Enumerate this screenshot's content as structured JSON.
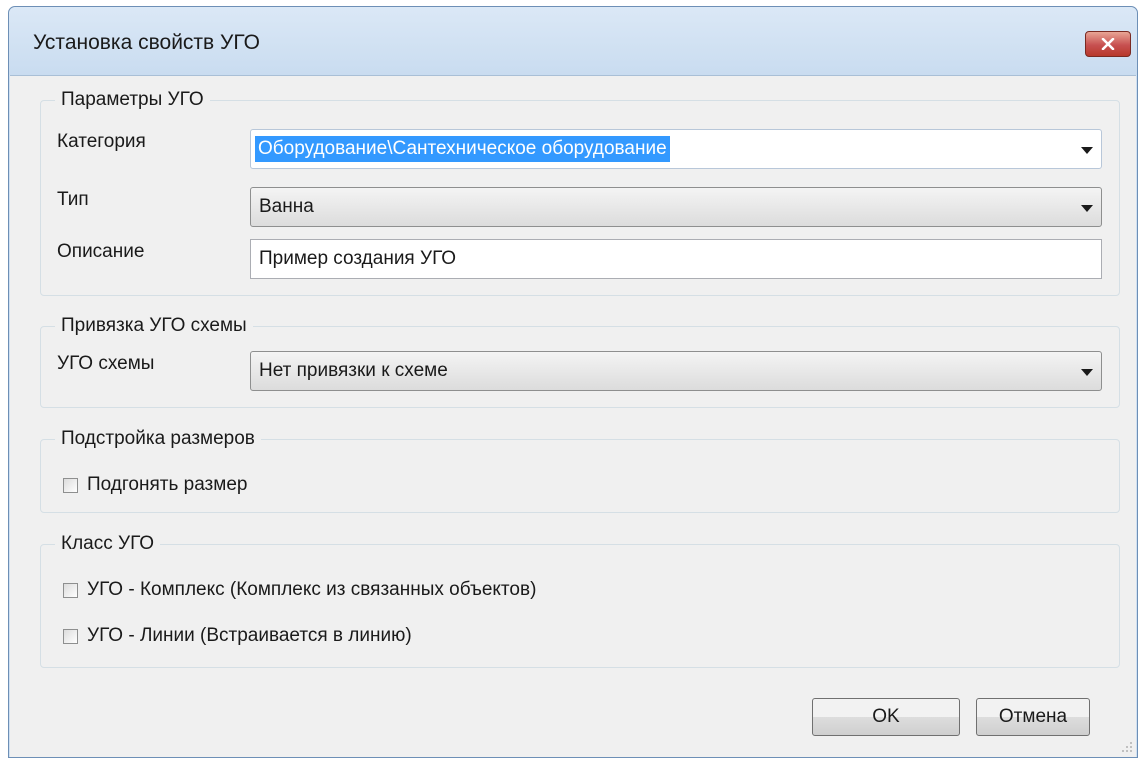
{
  "window": {
    "title": "Установка свойств УГО"
  },
  "group_params": {
    "legend": "Параметры УГО",
    "category_label": "Категория",
    "category_value": "Оборудование\\Сантехническое оборудование",
    "type_label": "Тип",
    "type_value": "Ванна",
    "description_label": "Описание",
    "description_value": "Пример создания УГО"
  },
  "group_binding": {
    "legend": "Привязка УГО схемы",
    "scheme_label": "УГО схемы",
    "scheme_value": "Нет привязки к схеме"
  },
  "group_size": {
    "legend": "Подстройка размеров",
    "fit_size_label": "Подгонять размер",
    "fit_size_checked": false
  },
  "group_class": {
    "legend": "Класс УГО",
    "complex_label": "УГО - Комплекс (Комплекс из связанных объектов)",
    "complex_checked": false,
    "line_label": "УГО - Линии (Встраивается в линию)",
    "line_checked": false
  },
  "buttons": {
    "ok": "OK",
    "cancel": "Отмена"
  },
  "icons": {
    "close": "close-icon",
    "dropdown": "chevron-down-icon",
    "resize": "resize-grip-icon"
  },
  "colors": {
    "selection": "#3399ff",
    "close_button": "#c75050",
    "titlebar": "#cfe0f2"
  }
}
